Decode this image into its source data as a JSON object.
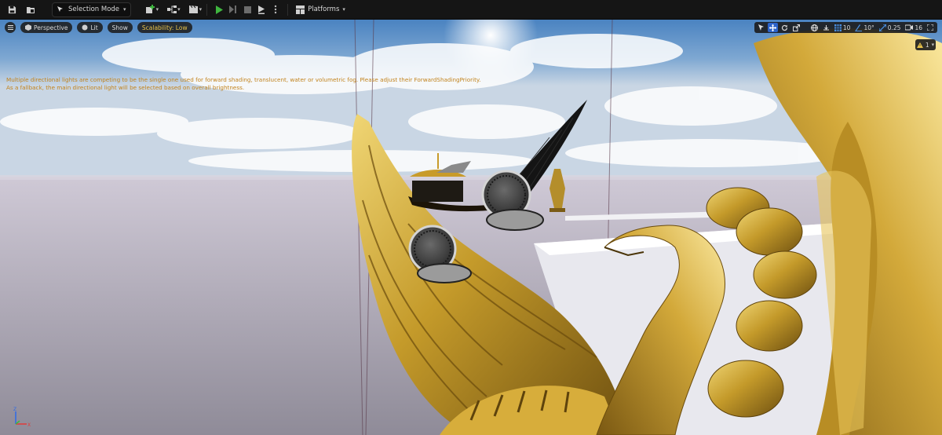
{
  "toolbar": {
    "mode_label": "Selection Mode",
    "platforms_label": "Platforms",
    "icons": [
      "save-icon",
      "content-browser-icon",
      "add-actor-icon",
      "blueprint-icon",
      "cinematics-icon",
      "play-icon",
      "frame-advance-icon",
      "stop-icon",
      "eject-icon",
      "more-options-icon",
      "platforms-icon"
    ]
  },
  "viewport": {
    "perspective_label": "Perspective",
    "lit_label": "Lit",
    "show_label": "Show",
    "scalability_label": "Scalability: Low",
    "warning_line1": "Multiple directional lights are competing to be the single one used for forward shading, translucent, water or volumetric fog. Please adjust their ForwardShadingPriority.",
    "warning_line2": "As a fallback, the main directional light will be selected based on overall brightness.",
    "grid_snap": "10",
    "rotation_snap": "10°",
    "scale_snap": "0.25",
    "camera_speed": "16",
    "warning_count": "1",
    "axis_labels": {
      "z": "Z",
      "x": "X"
    }
  },
  "colors": {
    "toolbar_bg": "#151515",
    "play_green": "#3fb63f",
    "active_blue": "#2c63c8",
    "warning_orange": "#c2831c",
    "scalability_yellow": "#e8c24a",
    "gold": "#c9a02a"
  }
}
